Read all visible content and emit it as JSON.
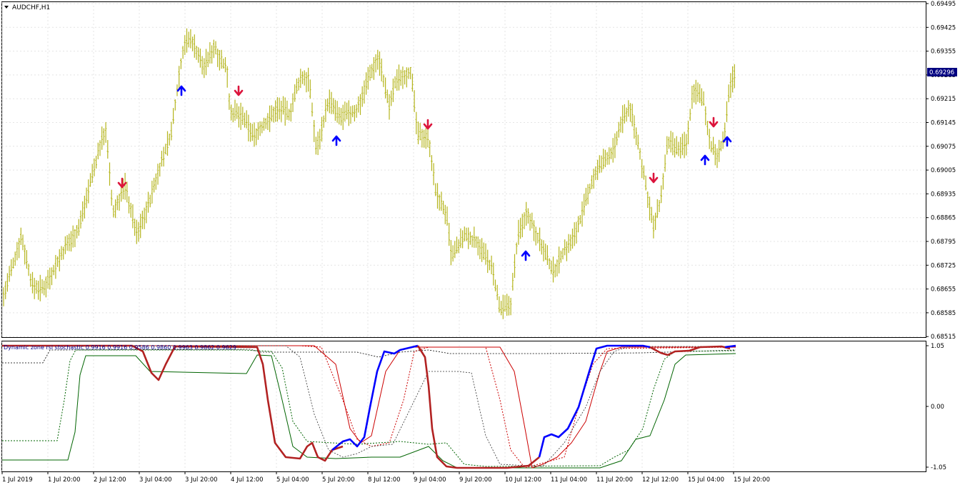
{
  "window": {
    "title": "AUDCHF,H1",
    "menu_icon": "triangle-down-icon"
  },
  "main_chart": {
    "symbol": "AUDCHF",
    "timeframe": "H1",
    "chart_type": "bar",
    "bar_color": "#b5b51e",
    "bg_color": "#ffffff",
    "grid": true,
    "price_axis": [
      "0.69495",
      "0.69425",
      "0.69355",
      "0.69285",
      "0.69215",
      "0.69145",
      "0.69075",
      "0.69005",
      "0.68935",
      "0.68865",
      "0.68795",
      "0.68725",
      "0.68655",
      "0.68585",
      "0.68515"
    ],
    "current_price": "0.69296",
    "price_label_color": "#000080",
    "arrow_colors": {
      "up": "#0000ff",
      "down": "#dc143c"
    }
  },
  "indicator": {
    "label": "Dynamic zone rsi stochastic 0.9916 0.9916 0.9586 0.9860 0.9963 0.9862 0.9629",
    "axis": [
      "1.05",
      "0.00",
      "-1.05"
    ],
    "colors": {
      "main_up": "#0000ff",
      "main_down": "#b22222",
      "red_line": "#cc0000",
      "green_line": "#006400"
    }
  },
  "time_axis": [
    "1 Jul 2019",
    "1 Jul 20:00",
    "2 Jul 12:00",
    "3 Jul 04:00",
    "3 Jul 20:00",
    "4 Jul 12:00",
    "5 Jul 04:00",
    "5 Jul 20:00",
    "8 Jul 12:00",
    "9 Jul 04:00",
    "9 Jul 20:00",
    "10 Jul 12:00",
    "11 Jul 04:00",
    "11 Jul 20:00",
    "12 Jul 12:00",
    "15 Jul 04:00",
    "15 Jul 20:00"
  ]
}
